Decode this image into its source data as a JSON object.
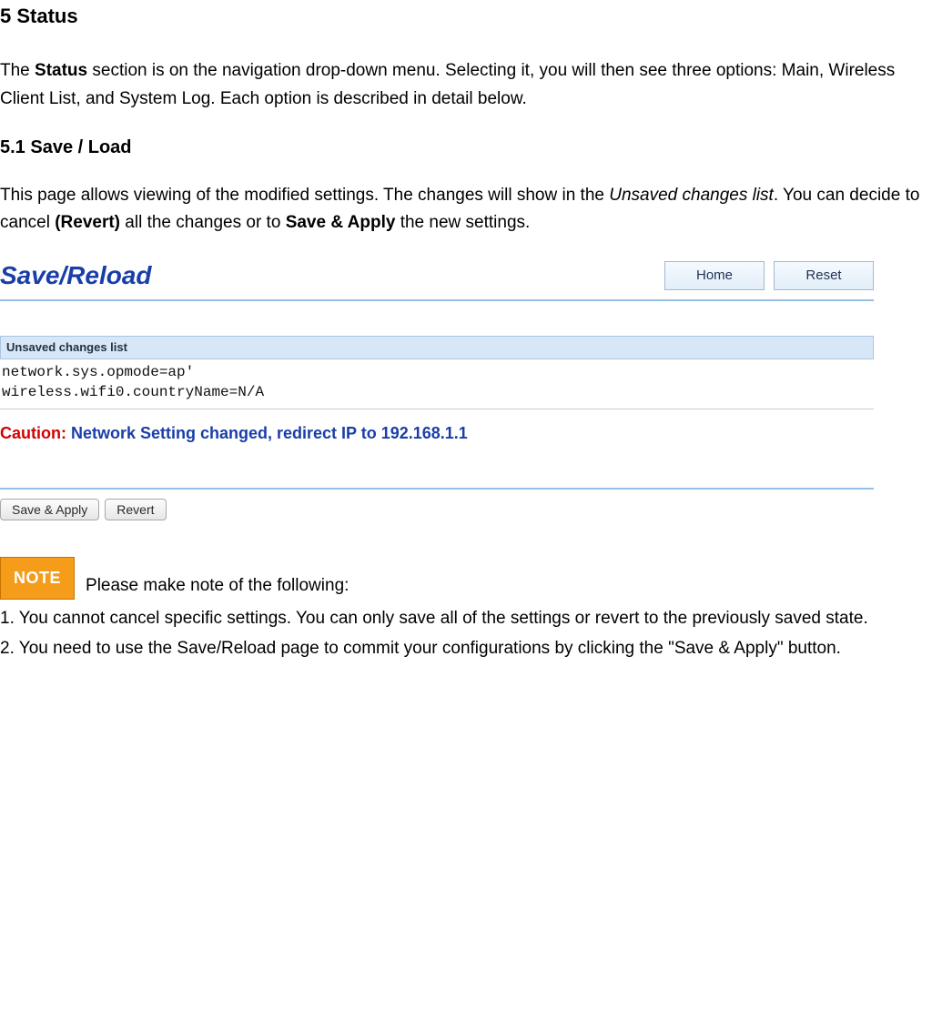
{
  "headings": {
    "main": "5 Status",
    "sub1": "5.1 Save / Load"
  },
  "para1": {
    "t1": "The ",
    "b1": "Status",
    "t2": " section is on the navigation drop-down menu. Selecting it, you will then see three options: Main, Wireless Client List, and System Log. Each option is described in detail below."
  },
  "para2": {
    "t1": "This page allows viewing of the modified settings. The changes will show in the ",
    "i1": "Unsaved changes list",
    "t2": ". You can decide to cancel ",
    "b1": "(Revert)",
    "t3": " all the changes or to ",
    "b2": "Save & Apply",
    "t4": " the new settings."
  },
  "screenshot": {
    "title": "Save/Reload",
    "tabs": {
      "home": "Home",
      "reset": "Reset"
    },
    "section_head": "Unsaved changes list",
    "pre": "network.sys.opmode=ap'\nwireless.wifi0.countryName=N/A",
    "caution_label": "Caution:",
    "caution_text": "  Network Setting changed, redirect IP to 192.168.1.1",
    "buttons": {
      "save_apply": "Save & Apply",
      "revert": "Revert"
    }
  },
  "note": {
    "badge": "NOTE",
    "lead": "Please make note of the following:",
    "items": [
      "1. You cannot cancel specific settings. You can only save all of the settings or revert to the previously saved state.",
      "2. You need to use the Save/Reload page to commit your configurations by clicking the \"Save & Apply\" button."
    ]
  }
}
